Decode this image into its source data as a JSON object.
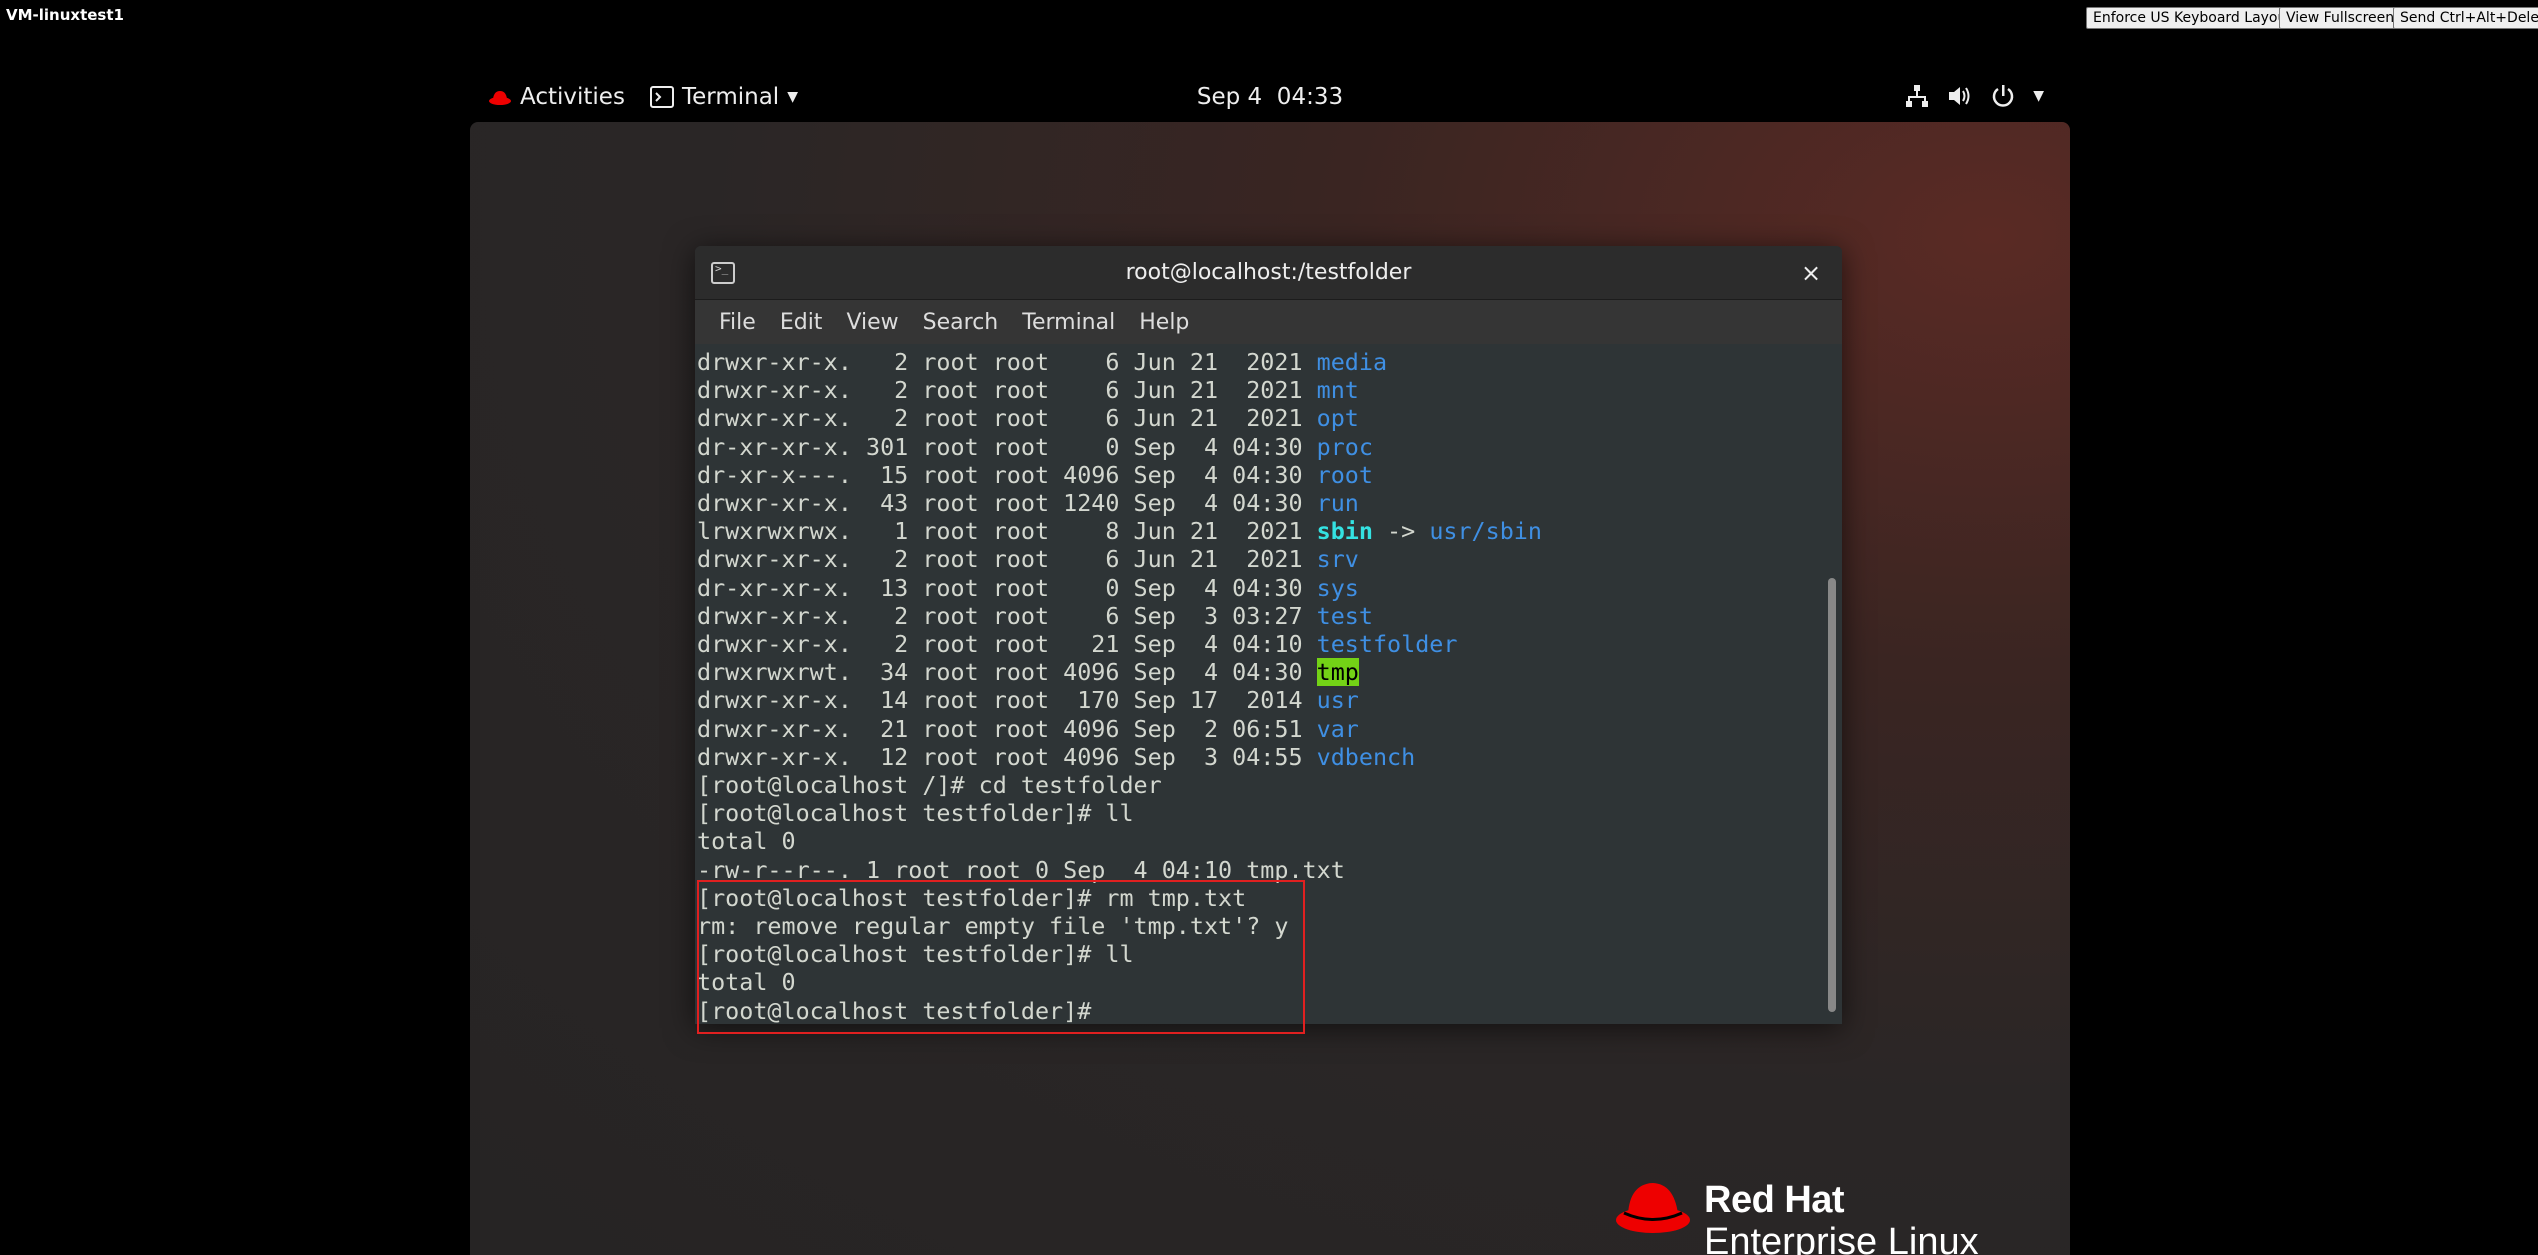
{
  "console": {
    "vm_name": "VM-linuxtest1",
    "buttons": [
      "Enforce US Keyboard Layout",
      "View Fullscreen",
      "Send Ctrl+Alt+Delete"
    ]
  },
  "topbar": {
    "activities": "Activities",
    "app_menu": "Terminal",
    "clock": "Sep 4  04:33",
    "icons": [
      "network-icon",
      "volume-icon",
      "power-icon",
      "chevron-down-icon"
    ]
  },
  "terminal": {
    "title": "root@localhost:/testfolder",
    "close": "×",
    "menu": [
      "File",
      "Edit",
      "View",
      "Search",
      "Terminal",
      "Help"
    ],
    "lines": [
      {
        "prefix": "drwxr-xr-x.   2 root root    6 Jun 21  2021 ",
        "name": "media",
        "kind": "dir"
      },
      {
        "prefix": "drwxr-xr-x.   2 root root    6 Jun 21  2021 ",
        "name": "mnt",
        "kind": "dir"
      },
      {
        "prefix": "drwxr-xr-x.   2 root root    6 Jun 21  2021 ",
        "name": "opt",
        "kind": "dir"
      },
      {
        "prefix": "dr-xr-xr-x. 301 root root    0 Sep  4 04:30 ",
        "name": "proc",
        "kind": "dir"
      },
      {
        "prefix": "dr-xr-x---.  15 root root 4096 Sep  4 04:30 ",
        "name": "root",
        "kind": "dir"
      },
      {
        "prefix": "drwxr-xr-x.  43 root root 1240 Sep  4 04:30 ",
        "name": "run",
        "kind": "dir"
      },
      {
        "prefix": "lrwxrwxrwx.   1 root root    8 Jun 21  2021 ",
        "name": "sbin",
        "kind": "link",
        "arrow": " -> ",
        "target": "usr/sbin"
      },
      {
        "prefix": "drwxr-xr-x.   2 root root    6 Jun 21  2021 ",
        "name": "srv",
        "kind": "dir"
      },
      {
        "prefix": "dr-xr-xr-x.  13 root root    0 Sep  4 04:30 ",
        "name": "sys",
        "kind": "dir"
      },
      {
        "prefix": "drwxr-xr-x.   2 root root    6 Sep  3 03:27 ",
        "name": "test",
        "kind": "dir"
      },
      {
        "prefix": "drwxr-xr-x.   2 root root   21 Sep  4 04:10 ",
        "name": "testfolder",
        "kind": "dir"
      },
      {
        "prefix": "drwxrwxrwt.  34 root root 4096 Sep  4 04:30 ",
        "name": "tmp",
        "kind": "sticky"
      },
      {
        "prefix": "drwxr-xr-x.  14 root root  170 Sep 17  2014 ",
        "name": "usr",
        "kind": "dir"
      },
      {
        "prefix": "drwxr-xr-x.  21 root root 4096 Sep  2 06:51 ",
        "name": "var",
        "kind": "dir"
      },
      {
        "prefix": "drwxr-xr-x.  12 root root 4096 Sep  3 04:55 ",
        "name": "vdbench",
        "kind": "dir"
      },
      {
        "prefix": "[root@localhost /]# cd testfolder"
      },
      {
        "prefix": "[root@localhost testfolder]# ll"
      },
      {
        "prefix": "total 0"
      },
      {
        "prefix": "-rw-r--r--. 1 root root 0 Sep  4 04:10 tmp.txt"
      },
      {
        "prefix": "[root@localhost testfolder]# rm tmp.txt"
      },
      {
        "prefix": "rm: remove regular empty file 'tmp.txt'? y"
      },
      {
        "prefix": "[root@localhost testfolder]# ll"
      },
      {
        "prefix": "total 0"
      },
      {
        "prefix": "[root@localhost testfolder]# "
      }
    ]
  },
  "branding": {
    "line1": "Red Hat",
    "line2": "Enterprise Linux",
    "color": "#ee0000"
  }
}
